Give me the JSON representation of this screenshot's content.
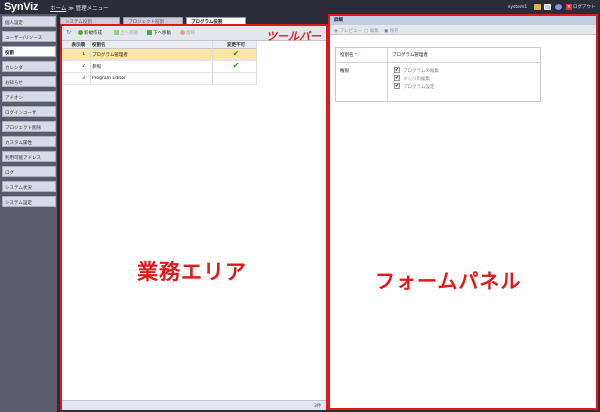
{
  "app": {
    "logo": "SynViz"
  },
  "breadcrumb": {
    "home": "ホーム",
    "separator": "≫",
    "current": "管理メニュー"
  },
  "header": {
    "user": "system1",
    "logout_label": "ログアウト"
  },
  "sidebar": {
    "items": [
      {
        "label": "個人設定"
      },
      {
        "label": "ユーザー/リソース"
      },
      {
        "label": "役割"
      },
      {
        "label": "カレンダ"
      },
      {
        "label": "お知らせ"
      },
      {
        "label": "アドオン"
      },
      {
        "label": "ログインユーザ"
      },
      {
        "label": "プロジェクト削除"
      },
      {
        "label": "カスタム属性"
      },
      {
        "label": "利用可能アドレス"
      },
      {
        "label": "ログ"
      },
      {
        "label": "システム状況"
      },
      {
        "label": "システム設定"
      }
    ]
  },
  "tabs": [
    {
      "label": "システム役割"
    },
    {
      "label": "プロジェクト役割"
    },
    {
      "label": "プログラム役割"
    }
  ],
  "toolbar": {
    "new_label": "新規作成",
    "up_label": "上へ移動",
    "down_label": "下へ移動",
    "delete_label": "削除",
    "annotation": "ツールバー"
  },
  "grid": {
    "headers": [
      "表示順",
      "役割名",
      "変更不可"
    ],
    "rows": [
      {
        "order": "1",
        "name": "プログラム管理者",
        "locked": "✔"
      },
      {
        "order": "2",
        "name": "参照",
        "locked": "✔"
      },
      {
        "order": "3",
        "name": "Program Editor",
        "locked": ""
      }
    ],
    "count": "3件"
  },
  "main_annotation": "業務エリア",
  "form": {
    "title": "詳細",
    "preview_label": "プレビュー",
    "edit_label": "編集",
    "save_label": "保存",
    "name_label": "役割名",
    "required_mark": "*",
    "name_value": "プログラム管理者",
    "perm_label": "権限",
    "permissions": [
      {
        "label": "プログラムの編集",
        "check": "✔"
      },
      {
        "label": "メンバの編集",
        "check": "✔"
      },
      {
        "label": "プログラム設定",
        "check": "✔"
      }
    ],
    "annotation": "フォームパネル"
  },
  "colors": {
    "highlight": "#e01818",
    "selected_row": "#fbe7a5",
    "check": "#3a9a1f"
  }
}
